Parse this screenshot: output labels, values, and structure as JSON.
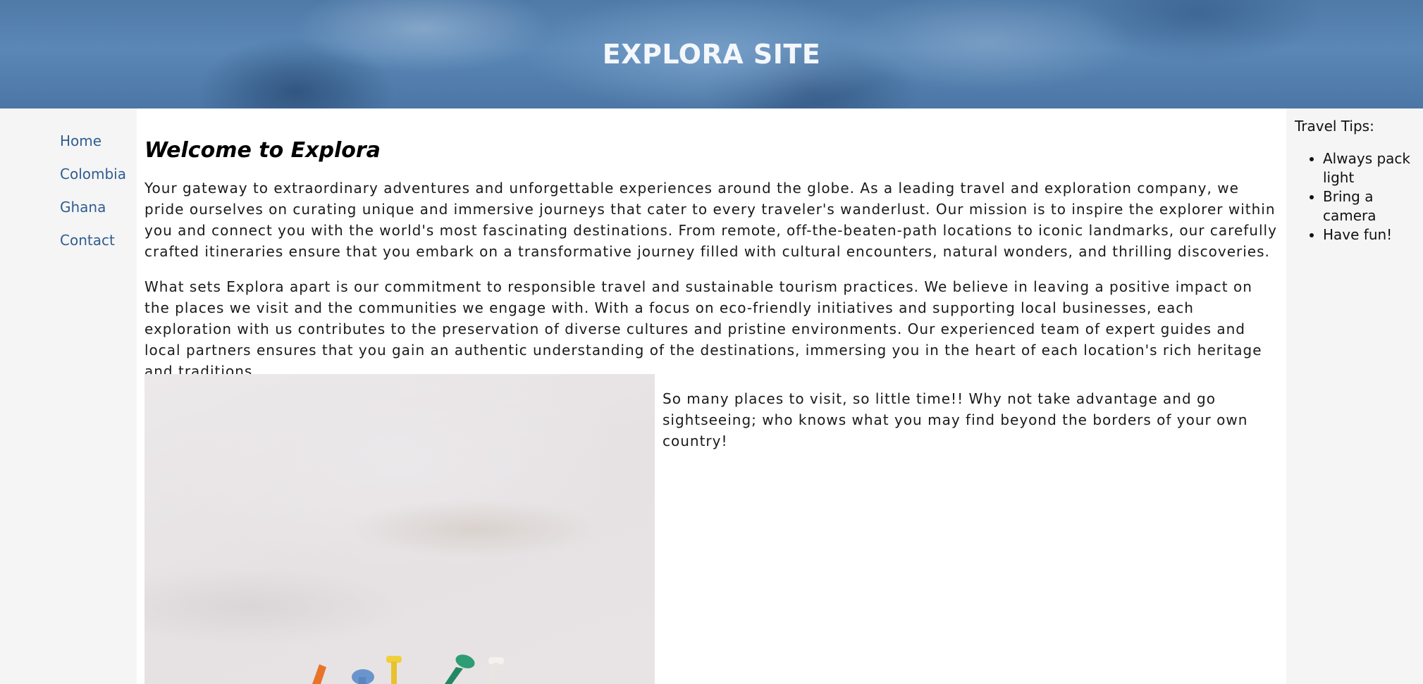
{
  "header": {
    "title": "EXPLORA SITE"
  },
  "nav": {
    "items": [
      {
        "label": "Home"
      },
      {
        "label": "Colombia"
      },
      {
        "label": "Ghana"
      },
      {
        "label": "Contact"
      }
    ]
  },
  "main": {
    "title": "Welcome to Explora",
    "paragraphs": [
      "Your gateway to extraordinary adventures and unforgettable experiences around the globe. As a leading travel and exploration company, we pride ourselves on curating unique and immersive journeys that cater to every traveler's wanderlust. Our mission is to inspire the explorer within you and connect you with the world's most fascinating destinations. From remote, off-the-beaten-path locations to iconic landmarks, our carefully crafted itineraries ensure that you embark on a transformative journey filled with cultural encounters, natural wonders, and thrilling discoveries.",
      "What sets Explora apart is our commitment to responsible travel and sustainable tourism practices. We believe in leaving a positive impact on the places we visit and the communities we engage with. With a focus on eco-friendly initiatives and supporting local businesses, each exploration with us contributes to the preservation of diverse cultures and pristine environments. Our experienced team of expert guides and local partners ensures that you gain an authentic understanding of the destinations, immersing you in the heart of each location's rich heritage and traditions."
    ],
    "side_text": "So many places to visit, so little time!! Why not take advantage and go sightseeing; who knows what you may find beyond the borders of your own country!"
  },
  "aside": {
    "title": "Travel Tips:",
    "tips": [
      {
        "text": "Always pack light"
      },
      {
        "text": "Bring a camera"
      },
      {
        "text": "Have fun!"
      }
    ]
  },
  "colors": {
    "header_bg": "#5a87b6",
    "nav_link": "#2f5d91",
    "sidebar_bg": "#f5f5f5"
  }
}
